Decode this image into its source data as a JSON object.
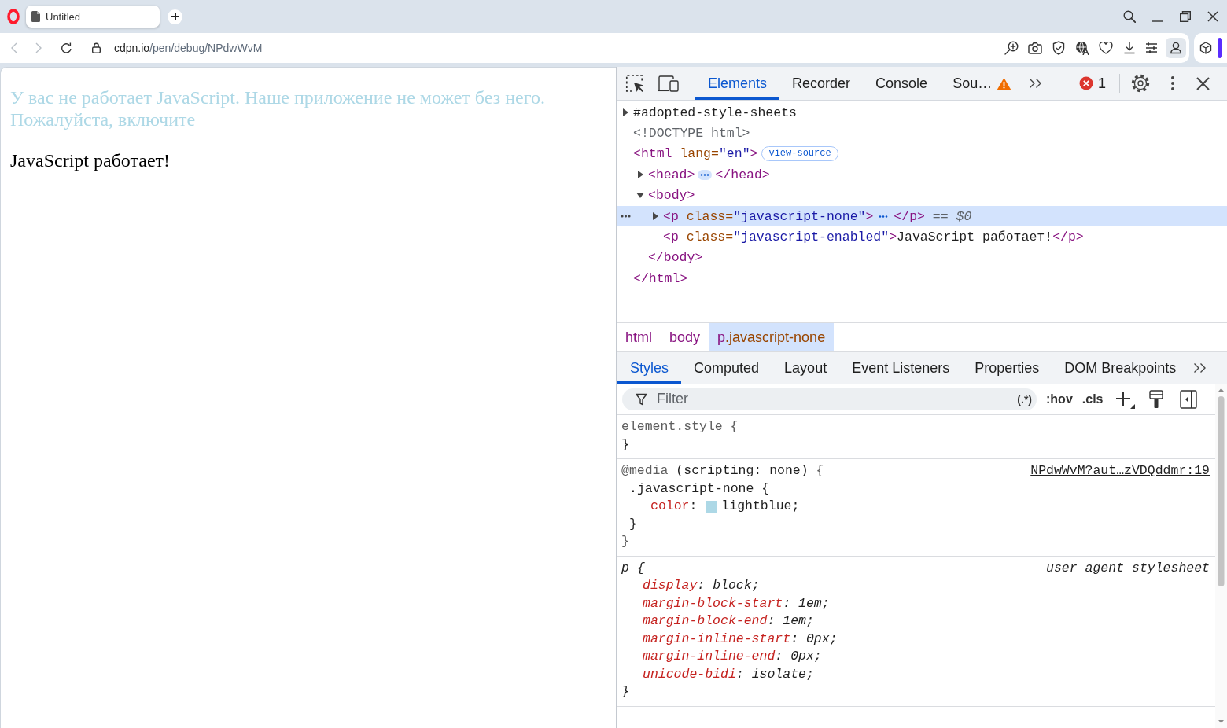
{
  "browser": {
    "tab": {
      "title": "Untitled"
    },
    "navigation": [
      {
        "kind": "back",
        "disabled": true
      },
      {
        "kind": "forward",
        "disabled": true
      },
      {
        "kind": "reload",
        "disabled": false
      }
    ],
    "address": {
      "host": "cdpn.io",
      "path": "/pen/debug/NPdwWvM"
    }
  },
  "page": {
    "paragraphs": [
      {
        "text": "У вас не работает JavaScript. Наше приложение не может без него. Пожалуйста, включите",
        "color": "#add8e6"
      },
      {
        "text": "JavaScript работает!",
        "color": "#000000"
      }
    ]
  },
  "devtools": {
    "panel_tabs": [
      {
        "label": "Elements",
        "selected": true,
        "warning": false
      },
      {
        "label": "Recorder",
        "selected": false,
        "warning": false
      },
      {
        "label": "Console",
        "selected": false,
        "warning": false
      },
      {
        "label": "Sou…",
        "selected": false,
        "warning": true
      }
    ],
    "error_count": "1",
    "dom_tree": [
      {
        "tokens": [
          {
            "kind": "plain",
            "text": "#adopted-style-sheets"
          }
        ],
        "expanded": false,
        "selected": false
      },
      {
        "tokens": [
          {
            "kind": "doctype",
            "text": "<!DOCTYPE html>"
          }
        ],
        "selected": false
      },
      {
        "tokens": [
          {
            "kind": "tag",
            "text": "<html"
          },
          {
            "kind": "attr-name",
            "text": " lang="
          },
          {
            "kind": "attr-value",
            "text": "\"en\""
          },
          {
            "kind": "tag",
            "text": ">"
          },
          {
            "kind": "badge",
            "text": "view-source"
          }
        ],
        "selected": false,
        "children": [
          {
            "tokens": [
              {
                "kind": "tag",
                "text": "<head>"
              },
              {
                "kind": "ellipsis"
              },
              {
                "kind": "tag",
                "text": "</head>"
              }
            ],
            "expanded": false,
            "selected": false
          },
          {
            "tokens": [
              {
                "kind": "tag",
                "text": "<body>"
              }
            ],
            "expanded": true,
            "selected": false,
            "children": [
              {
                "tokens": [
                  {
                    "kind": "tag",
                    "text": "<p"
                  },
                  {
                    "kind": "attr-name",
                    "text": " class="
                  },
                  {
                    "kind": "attr-value",
                    "text": "\"javascript-none\""
                  },
                  {
                    "kind": "tag",
                    "text": ">"
                  },
                  {
                    "kind": "ellipsis"
                  },
                  {
                    "kind": "tag",
                    "text": "</p>"
                  },
                  {
                    "kind": "marker",
                    "text": " == $0"
                  }
                ],
                "expanded": false,
                "selected": true
              },
              {
                "tokens": [
                  {
                    "kind": "tag",
                    "text": "<p"
                  },
                  {
                    "kind": "attr-name",
                    "text": " class="
                  },
                  {
                    "kind": "attr-value",
                    "text": "\"javascript-enabled\""
                  },
                  {
                    "kind": "tag",
                    "text": ">"
                  },
                  {
                    "kind": "text",
                    "text": "JavaScript работает!"
                  },
                  {
                    "kind": "tag",
                    "text": "</p>"
                  }
                ],
                "selected": false
              }
            ],
            "closing": [
              {
                "kind": "tag",
                "text": "</body>"
              }
            ]
          }
        ],
        "closing": [
          {
            "kind": "tag",
            "text": "</html>"
          }
        ]
      }
    ],
    "breadcrumbs": [
      {
        "tag": "html",
        "selected": false
      },
      {
        "tag": "body",
        "selected": false
      },
      {
        "tag": "p",
        "class_name": ".javascript-none",
        "selected": true
      }
    ],
    "sidebar_tabs": [
      {
        "label": "Styles",
        "selected": true
      },
      {
        "label": "Computed",
        "selected": false
      },
      {
        "label": "Layout",
        "selected": false
      },
      {
        "label": "Event Listeners",
        "selected": false
      },
      {
        "label": "Properties",
        "selected": false
      },
      {
        "label": "DOM Breakpoints",
        "selected": false
      }
    ],
    "filter": {
      "placeholder": "Filter",
      "regex_label": "(.*)"
    },
    "pane_toggles": [
      ":hov",
      ".cls"
    ],
    "rules": [
      {
        "kind": "inline",
        "header": [
          {
            "kind": "muted",
            "text": "element.style {"
          }
        ],
        "close": {
          "kind": "plain",
          "text": "}"
        }
      },
      {
        "kind": "author",
        "header": [
          {
            "kind": "muted",
            "text": "@media"
          },
          {
            "kind": "plain",
            "text": " (scripting: none) "
          },
          {
            "kind": "muted",
            "text": "{"
          }
        ],
        "source": {
          "kind": "link",
          "text": "NPdwWvM?aut…zVDQddmr:19"
        },
        "rules": [
          {
            "kind": "author",
            "header": [
              {
                "kind": "plain",
                "text": ".javascript-none {"
              }
            ],
            "declarations": [
              {
                "property": "color",
                "separator": ": ",
                "color": "#add8e6",
                "value": "lightblue;"
              }
            ],
            "close": {
              "kind": "plain",
              "text": "}"
            }
          }
        ],
        "close": {
          "kind": "muted",
          "text": "}"
        }
      },
      {
        "kind": "user-agent",
        "header": [
          {
            "kind": "plain",
            "text": "p {"
          }
        ],
        "source": {
          "kind": "label",
          "text": "user agent stylesheet"
        },
        "declarations": [
          {
            "property": "display",
            "separator": ": ",
            "value": "block;"
          },
          {
            "property": "margin-block-start",
            "separator": ": ",
            "value": "1em;"
          },
          {
            "property": "margin-block-end",
            "separator": ": ",
            "value": "1em;"
          },
          {
            "property": "margin-inline-start",
            "separator": ": ",
            "value": "0px;"
          },
          {
            "property": "margin-inline-end",
            "separator": ": ",
            "value": "0px;"
          },
          {
            "property": "unicode-bidi",
            "separator": ": ",
            "value": "isolate;"
          }
        ],
        "close": {
          "kind": "plain",
          "text": "}"
        }
      }
    ]
  }
}
